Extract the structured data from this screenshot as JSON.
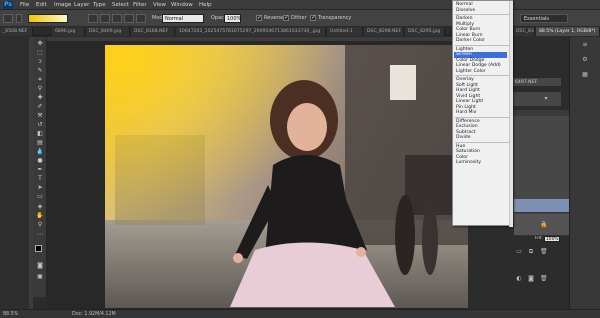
{
  "app": {
    "logo": "Ps"
  },
  "menubar": [
    "File",
    "Edit",
    "Image",
    "Layer",
    "Type",
    "Select",
    "Filter",
    "View",
    "Window",
    "Help"
  ],
  "options": {
    "mode_label": "Mode:",
    "mode_value": "Normal",
    "opacity_label": "Opacity:",
    "opacity_value": "100%",
    "reverse_label": "Reverse",
    "dither_label": "Dither",
    "transparency_label": "Transparency",
    "workspace": "Essentials",
    "gradient_colors": [
      "#f1c400",
      "#f7e37b",
      "#fff6c2"
    ]
  },
  "tabs": [
    "_6508.NEF",
    "6896.jpg",
    "DSC_8409.jpg",
    "DSC_8168.NEF",
    "10647202_1025475781675297_2909540713861033730_.jpg",
    "Untitled-1",
    "DSC_8298.NEF",
    "DSC_8295.jpg",
    "DSC_8395",
    "88.5% (Layer 1, RGB/8*)"
  ],
  "status": {
    "zoom": "88.5%",
    "doc": "Doc: 1.92M/4.12M"
  },
  "layers_panel": {
    "file_label": "6497.NEF",
    "opacity_label": "Opacity:",
    "opacity_value": "100%",
    "fill_label": "Fill:",
    "fill_value": "100%"
  },
  "blend_modes": {
    "groups": [
      [
        "Normal",
        "Dissolve"
      ],
      [
        "Darken",
        "Multiply",
        "Color Burn",
        "Linear Burn",
        "Darker Color"
      ],
      [
        "Lighten",
        "Screen",
        "Color Dodge",
        "Linear Dodge (Add)",
        "Lighter Color"
      ],
      [
        "Overlay",
        "Soft Light",
        "Hard Light",
        "Vivid Light",
        "Linear Light",
        "Pin Light",
        "Hard Mix"
      ],
      [
        "Difference",
        "Exclusion",
        "Subtract",
        "Divide"
      ],
      [
        "Hue",
        "Saturation",
        "Color",
        "Luminosity"
      ]
    ],
    "selected": "Screen"
  },
  "colors": {
    "accent": "#3d6fd9",
    "menubar": "#3c3c3c",
    "panel": "#474747"
  }
}
